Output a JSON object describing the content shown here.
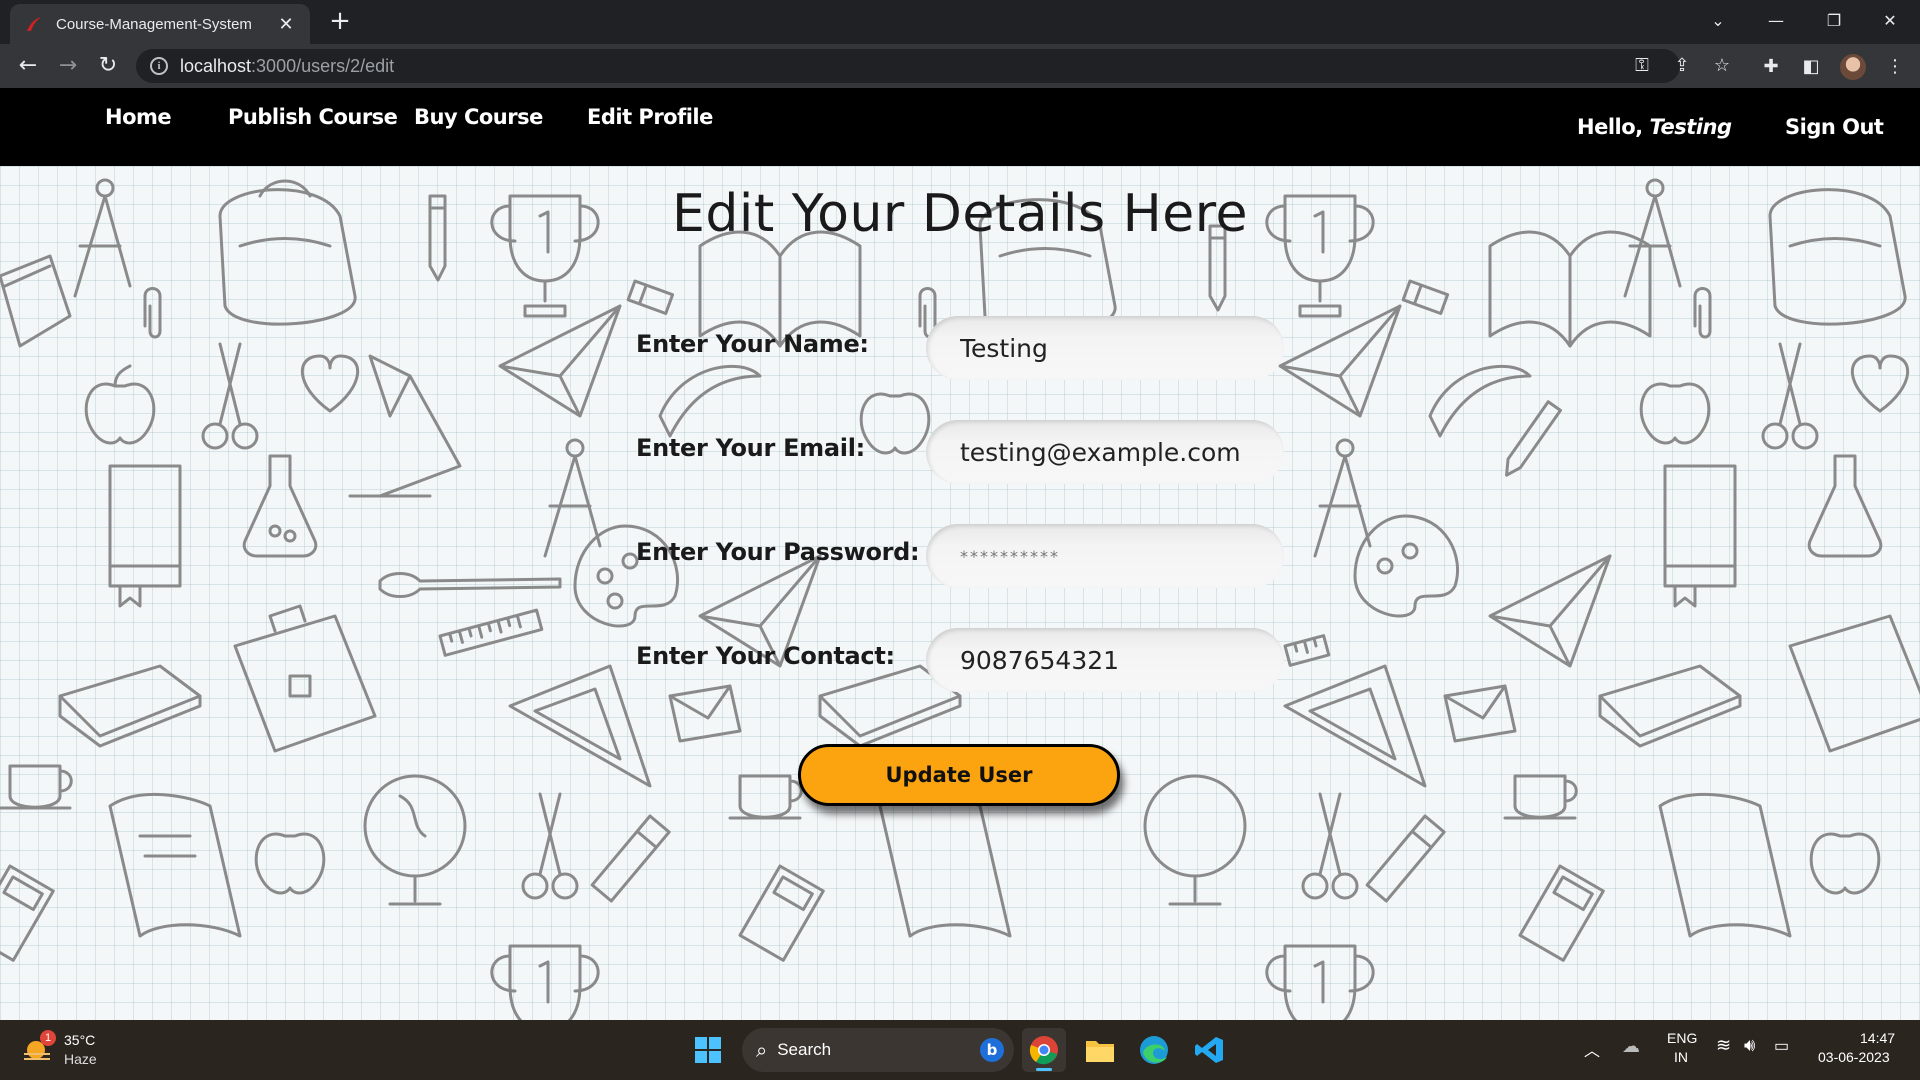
{
  "browser": {
    "tab_title": "Course-Management-System",
    "new_tab_symbol": "+",
    "url_host": "localhost",
    "url_path": ":3000/users/2/edit"
  },
  "nav": {
    "home": "Home",
    "publish_course": "Publish Course",
    "buy_course": "Buy Course",
    "edit_profile": "Edit Profile",
    "greeting": "Hello,",
    "username": "Testing",
    "sign_out": "Sign Out"
  },
  "form": {
    "heading": "Edit Your Details Here",
    "name_label": "Enter Your Name:",
    "name_value": "Testing",
    "email_label": "Enter Your Email:",
    "email_value": "testing@example.com",
    "password_label": "Enter Your Password:",
    "password_value": "**********",
    "contact_label": "Enter Your Contact:",
    "contact_value": "9087654321",
    "submit_label": "Update User"
  },
  "taskbar": {
    "weather_badge": "1",
    "temperature": "35°C",
    "weather": "Haze",
    "search_label": "Search",
    "language": "ENG",
    "region": "IN",
    "time": "14:47",
    "date": "03-06-2023"
  },
  "colors": {
    "nav_background": "#000000",
    "button_accent": "#fca410",
    "chrome_dark": "#202124",
    "chrome_toolbar": "#35363a"
  }
}
